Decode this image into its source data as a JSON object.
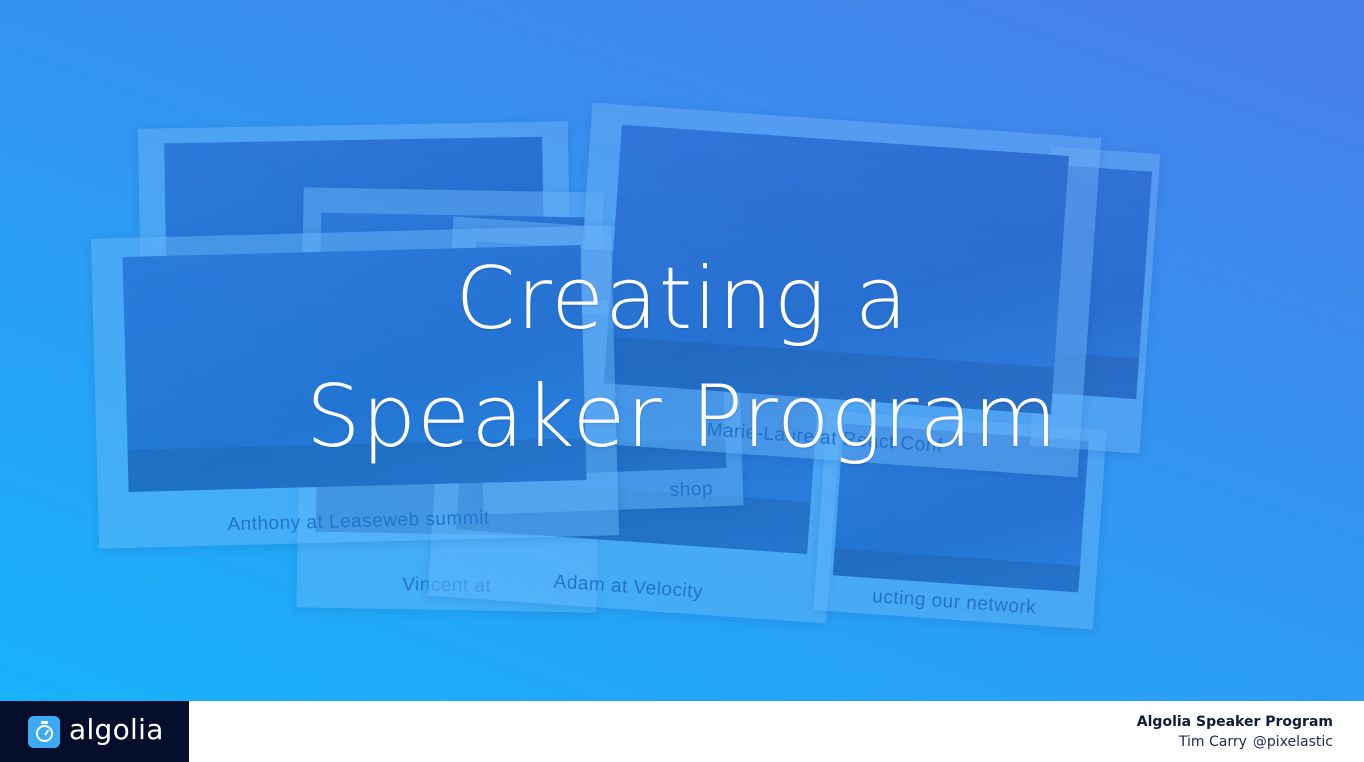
{
  "slide": {
    "title_line1": "Creating a",
    "title_line2": "Speaker Program"
  },
  "photos": [
    {
      "caption": "Anthony at Leaseweb summit"
    },
    {
      "caption": "Vincent at"
    },
    {
      "caption": "Adam at Velocity"
    },
    {
      "caption": "shop"
    },
    {
      "caption": "Marie-Laure at React Conf"
    },
    {
      "caption": "ucting our network"
    }
  ],
  "footer": {
    "logo_text": "algolia",
    "program": "Algolia Speaker Program",
    "speaker": "Tim Carry",
    "handle": "@pixelastic"
  },
  "colors": {
    "footer_logo_bg": "#050f2c",
    "logo_mark": "#3ca9f5",
    "gradient_start": "#4a7fe9",
    "gradient_end": "#18b2fb"
  }
}
